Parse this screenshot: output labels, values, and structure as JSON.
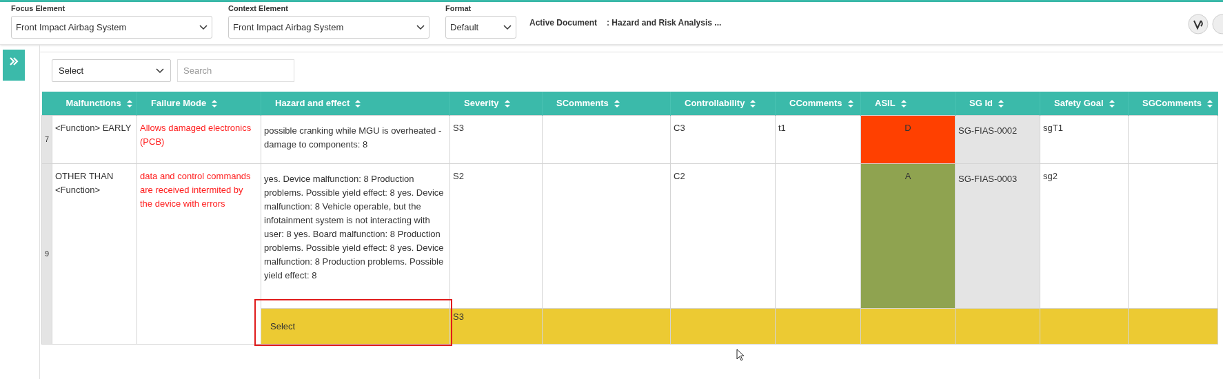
{
  "top_bar": {
    "fields": [
      {
        "label": "Focus Element",
        "value": "Front Impact Airbag System",
        "kind": "wide"
      },
      {
        "label": "Context Element",
        "value": "Front Impact Airbag System",
        "kind": "wide"
      },
      {
        "label": "Format",
        "value": "Default",
        "kind": "narrow"
      }
    ],
    "active_document": {
      "label": "Active Document",
      "value": ": Hazard and Risk Analysis ..."
    }
  },
  "toolbar": {
    "filter": {
      "value": "Select"
    },
    "search": {
      "placeholder": "Search"
    }
  },
  "table": {
    "columns": [
      "Malfunctions",
      "Failure Mode",
      "Hazard and effect",
      "Severity",
      "SComments",
      "Controllability",
      "CComments",
      "ASIL",
      "SG Id",
      "Safety Goal",
      "SGComments"
    ],
    "rows": [
      {
        "row_number": "7",
        "malfunction": "<Function> EARLY",
        "failure_mode": "Allows damaged electronics (PCB)",
        "hazard": "possible cranking while MGU is overheated - damage to components: 8",
        "severity": "S3",
        "controllability": "C3",
        "c_comments": "t1",
        "asil": {
          "value": "D",
          "color": "#ff4000"
        },
        "sg_id": "SG-FIAS-0002",
        "safety_goal": "sgT1",
        "sub_rows": []
      },
      {
        "row_number": "9",
        "malfunction": "OTHER THAN <Function>",
        "failure_mode": "data and control commands are received intermited by the device with errors",
        "hazard": "yes. Device malfunction: 8 Production problems. Possible yield effect: 8 yes. Device malfunction: 8 Vehicle operable, but the infotainment system is not interacting with user: 8 yes. Board malfunction: 8 Production problems. Possible yield effect: 8 yes. Device malfunction: 8 Production problems. Possible yield effect: 8",
        "severity": "S2",
        "controllability": "C2",
        "asil": {
          "value": "A",
          "color": "#8fa350"
        },
        "sg_id": "SG-FIAS-0003",
        "safety_goal": "sg2",
        "sub_rows": [
          {
            "hazard_select": "Select",
            "severity": "S3",
            "highlighted": true
          }
        ]
      }
    ]
  }
}
